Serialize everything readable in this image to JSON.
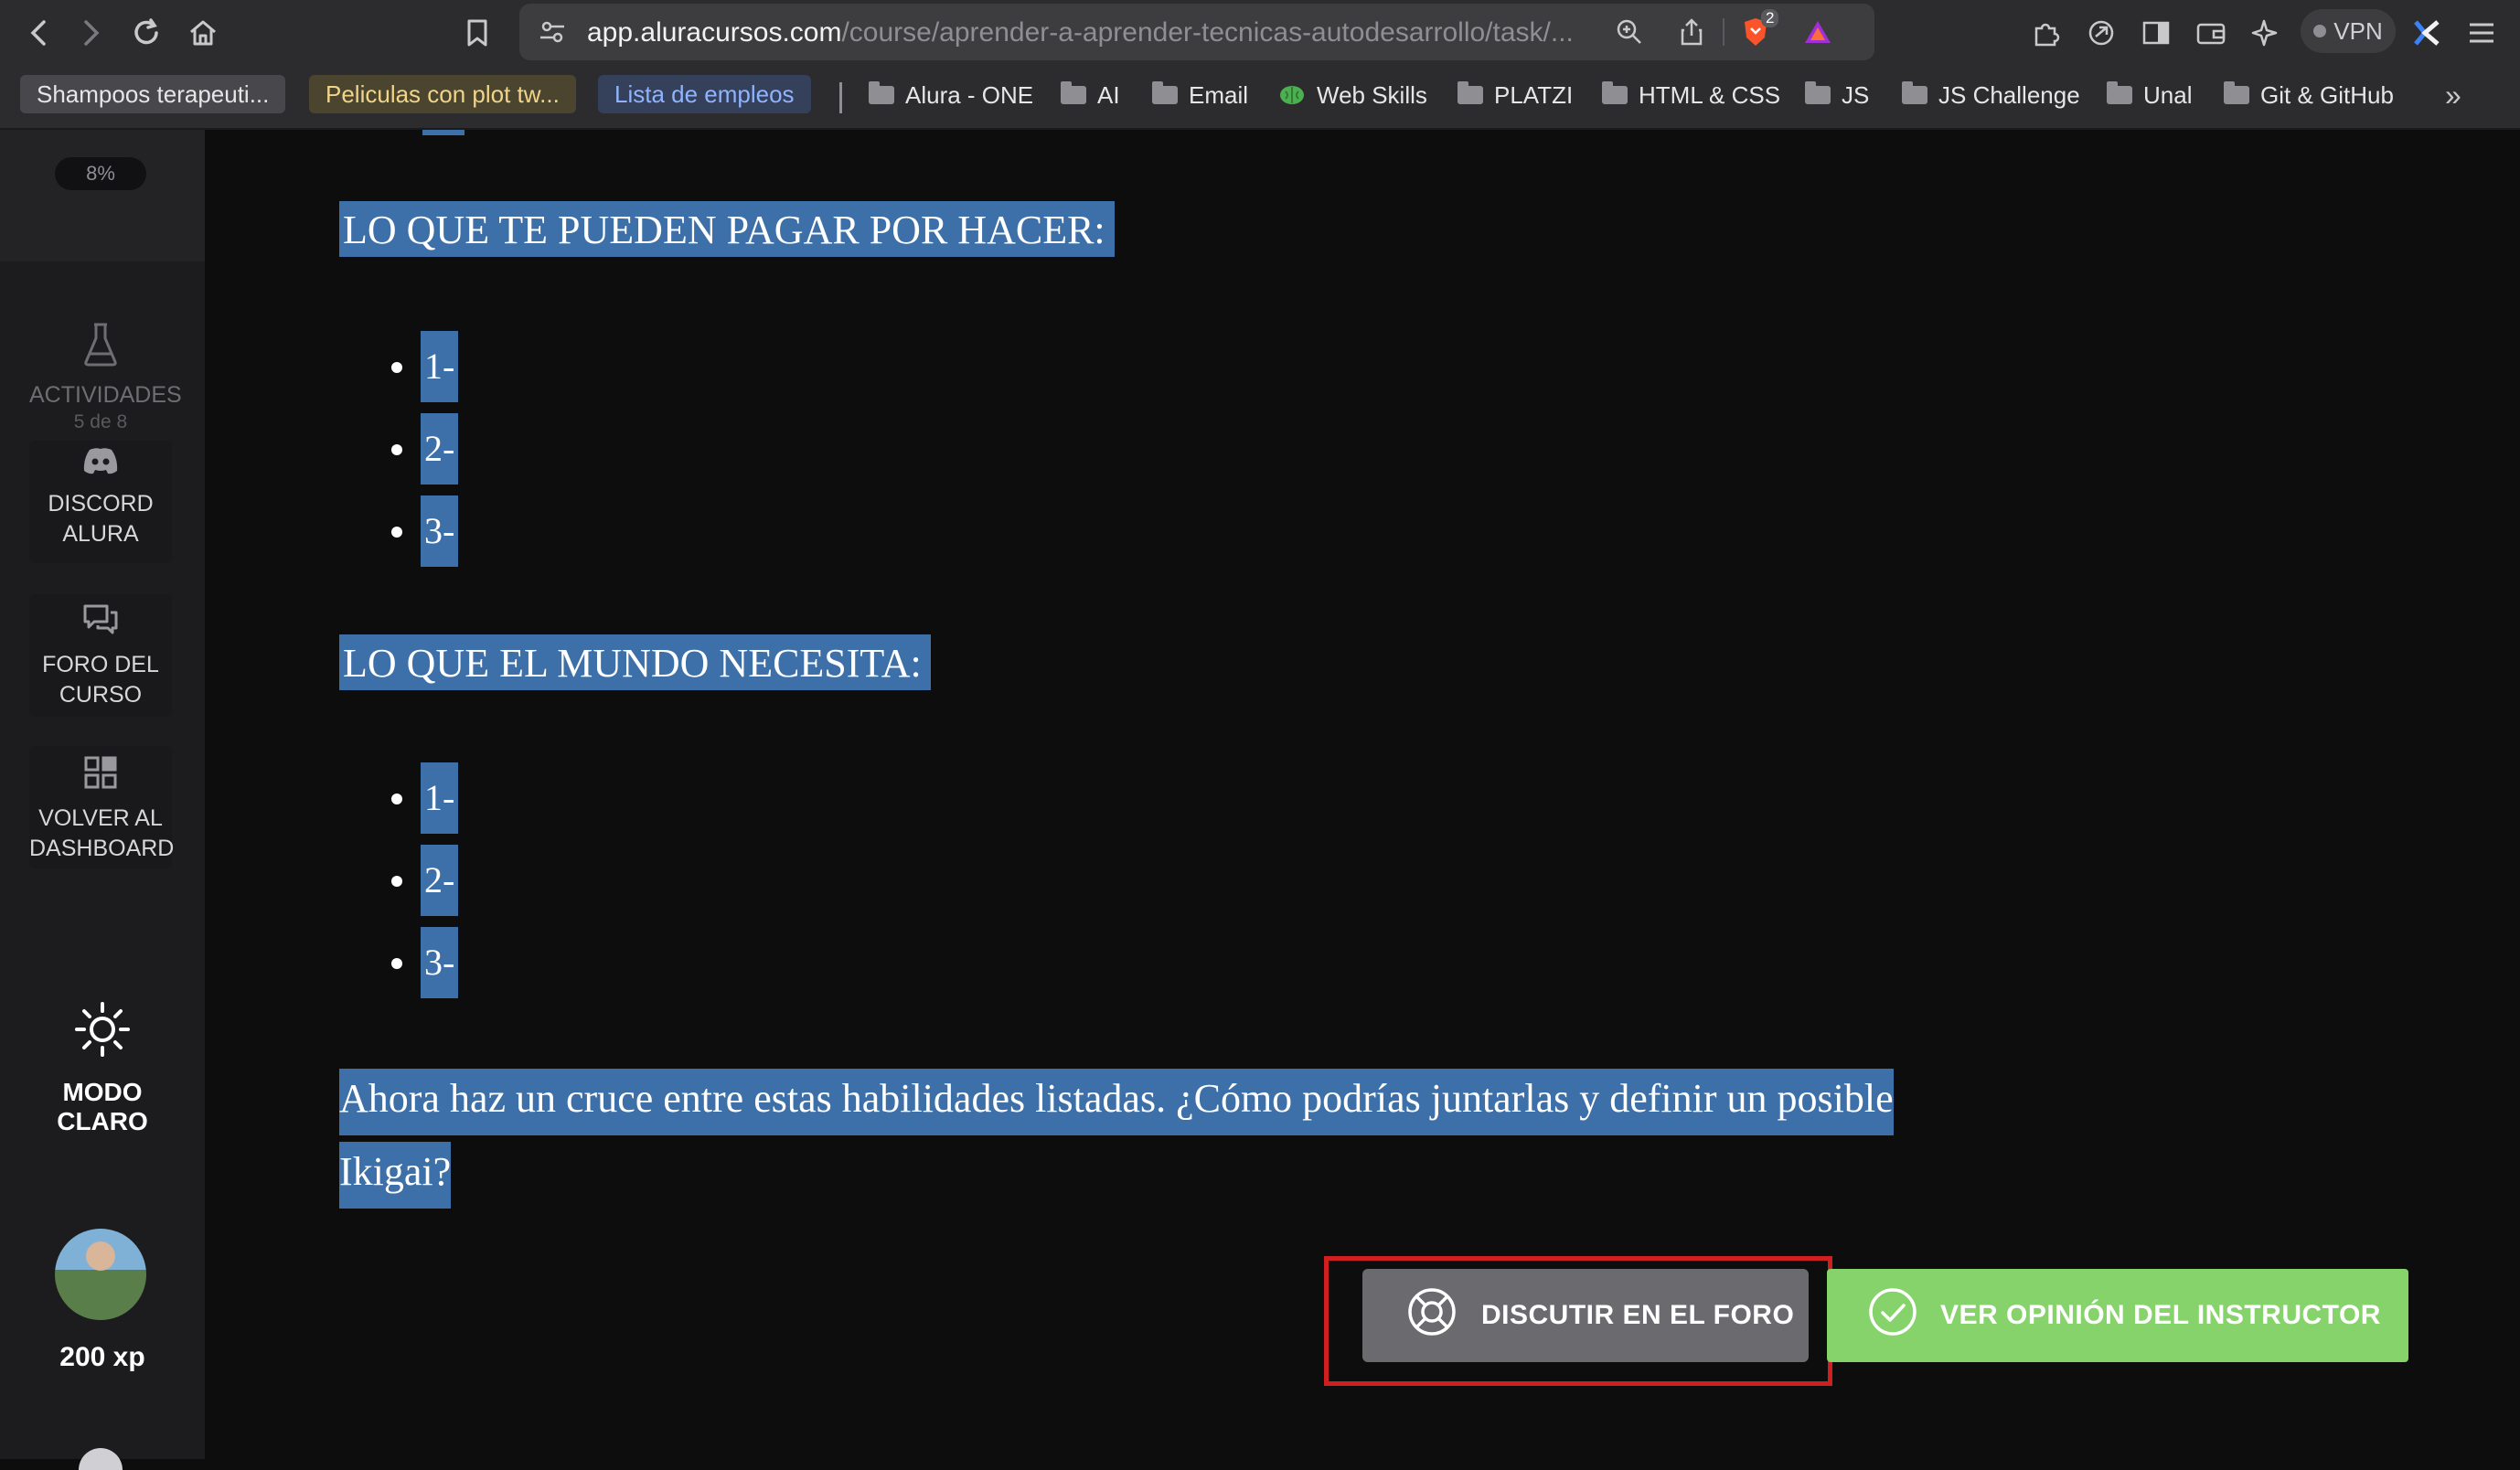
{
  "browser": {
    "url_host": "app.aluracursos.com",
    "url_path": "/course/aprender-a-aprender-tecnicas-autodesarrollo/task/...",
    "shield_badge": "2",
    "vpn_label": "VPN"
  },
  "bookmarks": {
    "pills": [
      {
        "label": "Shampoos terapeuti...",
        "color": "#e6e6e6",
        "bg": "#48484c"
      },
      {
        "label": "Peliculas con plot tw...",
        "color": "#f0d48a",
        "bg": "#4b4530"
      },
      {
        "label": "Lista de empleos",
        "color": "#8fb4ff",
        "bg": "#35405a"
      }
    ],
    "items": [
      "Alura - ONE",
      "AI",
      "Email",
      "Web Skills",
      "PLATZI",
      "HTML & CSS",
      "JS",
      "JS Challenge",
      "Unal",
      "Git & GitHub"
    ],
    "overflow": "»"
  },
  "sidebar": {
    "progress": "8%",
    "activities_label": "ACTIVIDADES",
    "activities_count": "5 de 8",
    "discord_line1": "DISCORD",
    "discord_line2": "ALURA",
    "forum_line1": "FORO DEL",
    "forum_line2": "CURSO",
    "dashboard_line1": "VOLVER AL",
    "dashboard_line2": "DASHBOARD",
    "mode_line1": "MODO",
    "mode_line2": "CLARO",
    "xp": "200 xp"
  },
  "content": {
    "heading_pay": "LO QUE TE PUEDEN PAGAR POR HACER:",
    "list_pay": [
      "1-",
      "2-",
      "3-"
    ],
    "heading_world": "LO QUE EL MUNDO NECESITA:",
    "list_world": [
      "1-",
      "2-",
      "3-"
    ],
    "paragraph_line1": "Ahora haz un cruce entre estas habilidades listadas. ¿Cómo podrías juntarlas y definir un posible",
    "paragraph_line2": "Ikigai?"
  },
  "actions": {
    "forum_button": "DISCUTIR EN EL FORO",
    "instructor_button": "VER OPINIÓN DEL INSTRUCTOR"
  },
  "colors": {
    "selection": "#3d6fa8",
    "instructor_green": "#86d36b",
    "highlight_red": "#d01f1f"
  }
}
